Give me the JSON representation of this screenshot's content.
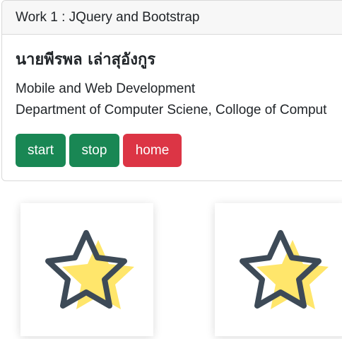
{
  "card": {
    "header_title": "Work 1 : JQuery and Bootstrap",
    "name": "นายพีรพล เล่าสุอังกูร",
    "subtitle_1": "Mobile and Web Development",
    "subtitle_2": "Department of Computer Sciene, Colloge of Comput"
  },
  "buttons": {
    "start_label": "start",
    "stop_label": "stop",
    "home_label": "home"
  },
  "tiles": [
    {
      "icon": "star-icon"
    },
    {
      "icon": "star-icon"
    }
  ],
  "colors": {
    "success": "#198754",
    "danger": "#dc3545",
    "star_fill": "#ffe66b",
    "star_stroke": "#3d4a57"
  }
}
